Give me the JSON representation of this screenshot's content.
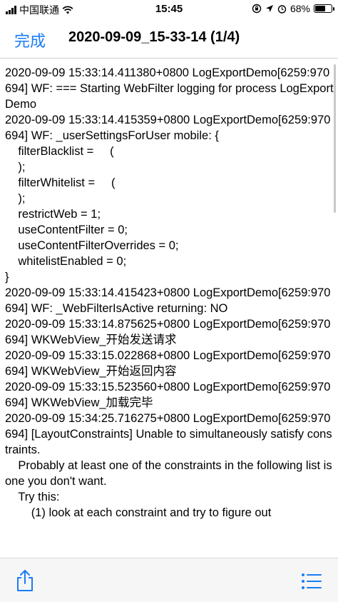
{
  "status_bar": {
    "carrier": "中国联通",
    "time": "15:45",
    "battery_percent": "68%",
    "battery_level": 0.68
  },
  "nav": {
    "done_label": "完成",
    "title": "2020-09-09_15-33-14 (1/4)"
  },
  "log": {
    "lines": [
      "2020-09-09 15:33:14.411380+0800 LogExportDemo[6259:970694] WF: === Starting WebFilter logging for process LogExportDemo",
      "2020-09-09 15:33:14.415359+0800 LogExportDemo[6259:970694] WF: _userSettingsForUser mobile: {",
      "    filterBlacklist =     (",
      "    );",
      "    filterWhitelist =     (",
      "    );",
      "    restrictWeb = 1;",
      "    useContentFilter = 0;",
      "    useContentFilterOverrides = 0;",
      "    whitelistEnabled = 0;",
      "}",
      "2020-09-09 15:33:14.415423+0800 LogExportDemo[6259:970694] WF: _WebFilterIsActive returning: NO",
      "2020-09-09 15:33:14.875625+0800 LogExportDemo[6259:970694] WKWebView_开始发送请求",
      "2020-09-09 15:33:15.022868+0800 LogExportDemo[6259:970694] WKWebView_开始返回内容",
      "2020-09-09 15:33:15.523560+0800 LogExportDemo[6259:970694] WKWebView_加载完毕",
      "2020-09-09 15:34:25.716275+0800 LogExportDemo[6259:970694] [LayoutConstraints] Unable to simultaneously satisfy constraints.",
      "\tProbably at least one of the constraints in the following list is one you don't want.",
      "\tTry this:",
      "\t\t(1) look at each constraint and try to figure out"
    ]
  },
  "toolbar": {
    "share_icon": "share-icon",
    "list_icon": "list-icon",
    "accent_color": "#1a7cf5"
  }
}
